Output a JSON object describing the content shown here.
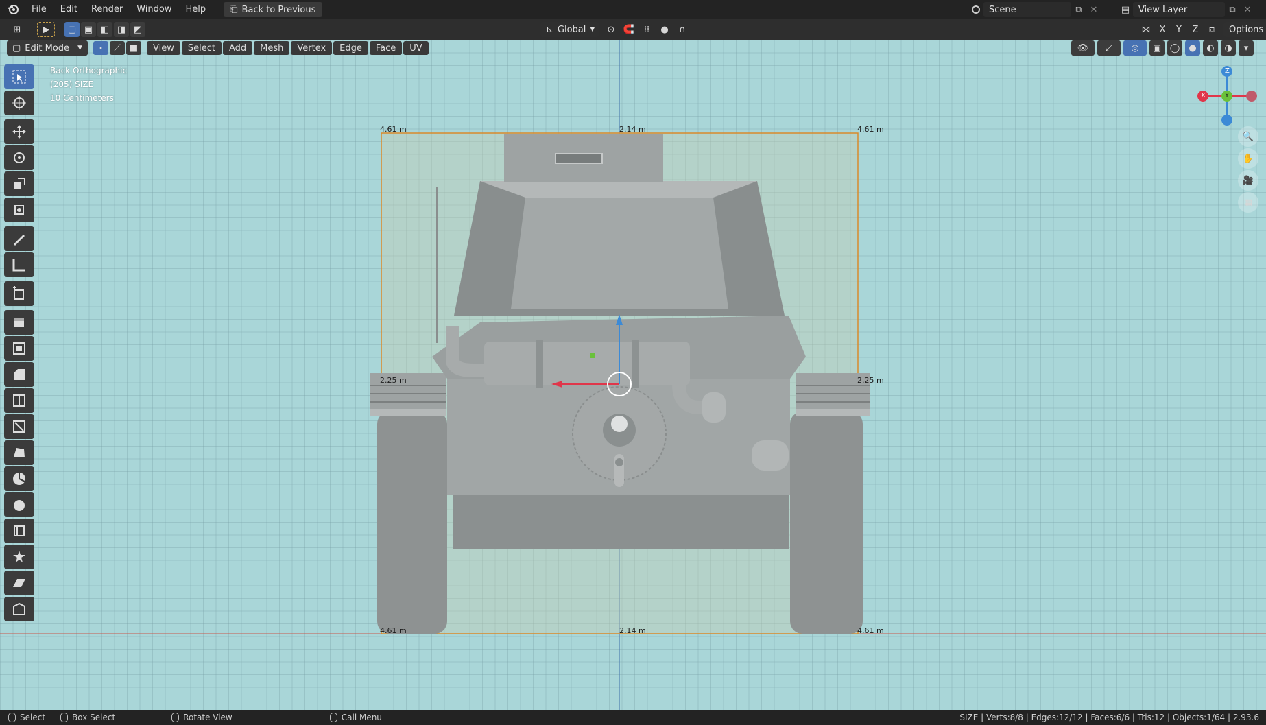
{
  "menubar": {
    "items": [
      "File",
      "Edit",
      "Render",
      "Window",
      "Help"
    ],
    "back_button": "Back to Previous",
    "scene": "Scene",
    "view_layer": "View Layer"
  },
  "toolheader": {
    "transform_orientation": "Global",
    "axes": [
      "X",
      "Y",
      "Z"
    ],
    "options": "Options"
  },
  "viewport_header": {
    "mode": "Edit Mode",
    "menus": [
      "View",
      "Select",
      "Add",
      "Mesh",
      "Vertex",
      "Edge",
      "Face",
      "UV"
    ]
  },
  "overlay": {
    "view_name": "Back Orthographic",
    "object_info": "(205) SIZE",
    "grid_scale": "10 Centimeters"
  },
  "dimensions": {
    "top_left": "4.61 m",
    "top_center": "2.14 m",
    "top_right": "4.61 m",
    "mid_left": "2.25 m",
    "mid_right": "2.25 m",
    "bottom_left": "4.61 m",
    "bottom_center": "2.14 m",
    "bottom_right": "4.61 m"
  },
  "gizmo": {
    "z": "Z",
    "y": "Y",
    "x": "X"
  },
  "statusbar": {
    "select": "Select",
    "box_select": "Box Select",
    "rotate_view": "Rotate View",
    "call_menu": "Call Menu",
    "stats": "SIZE | Verts:8/8 | Edges:12/12 | Faces:6/6 | Tris:12 | Objects:1/64 | 2.93.6"
  },
  "colors": {
    "accent": "#4772b3",
    "viewport_bg": "#a9d6d8",
    "bbox": "#d98a2a",
    "axis_x": "#e0364a",
    "axis_y": "#6ac13b",
    "axis_z": "#3c8ad6"
  },
  "tools": [
    "select-box",
    "cursor",
    "move",
    "rotate",
    "scale",
    "transform",
    "annotate",
    "measure",
    "add-cube",
    "extrude",
    "inset",
    "bevel",
    "loop-cut",
    "knife",
    "poly-build",
    "spin",
    "smooth",
    "edge-slide",
    "shrink-fatten",
    "shear",
    "rip"
  ]
}
